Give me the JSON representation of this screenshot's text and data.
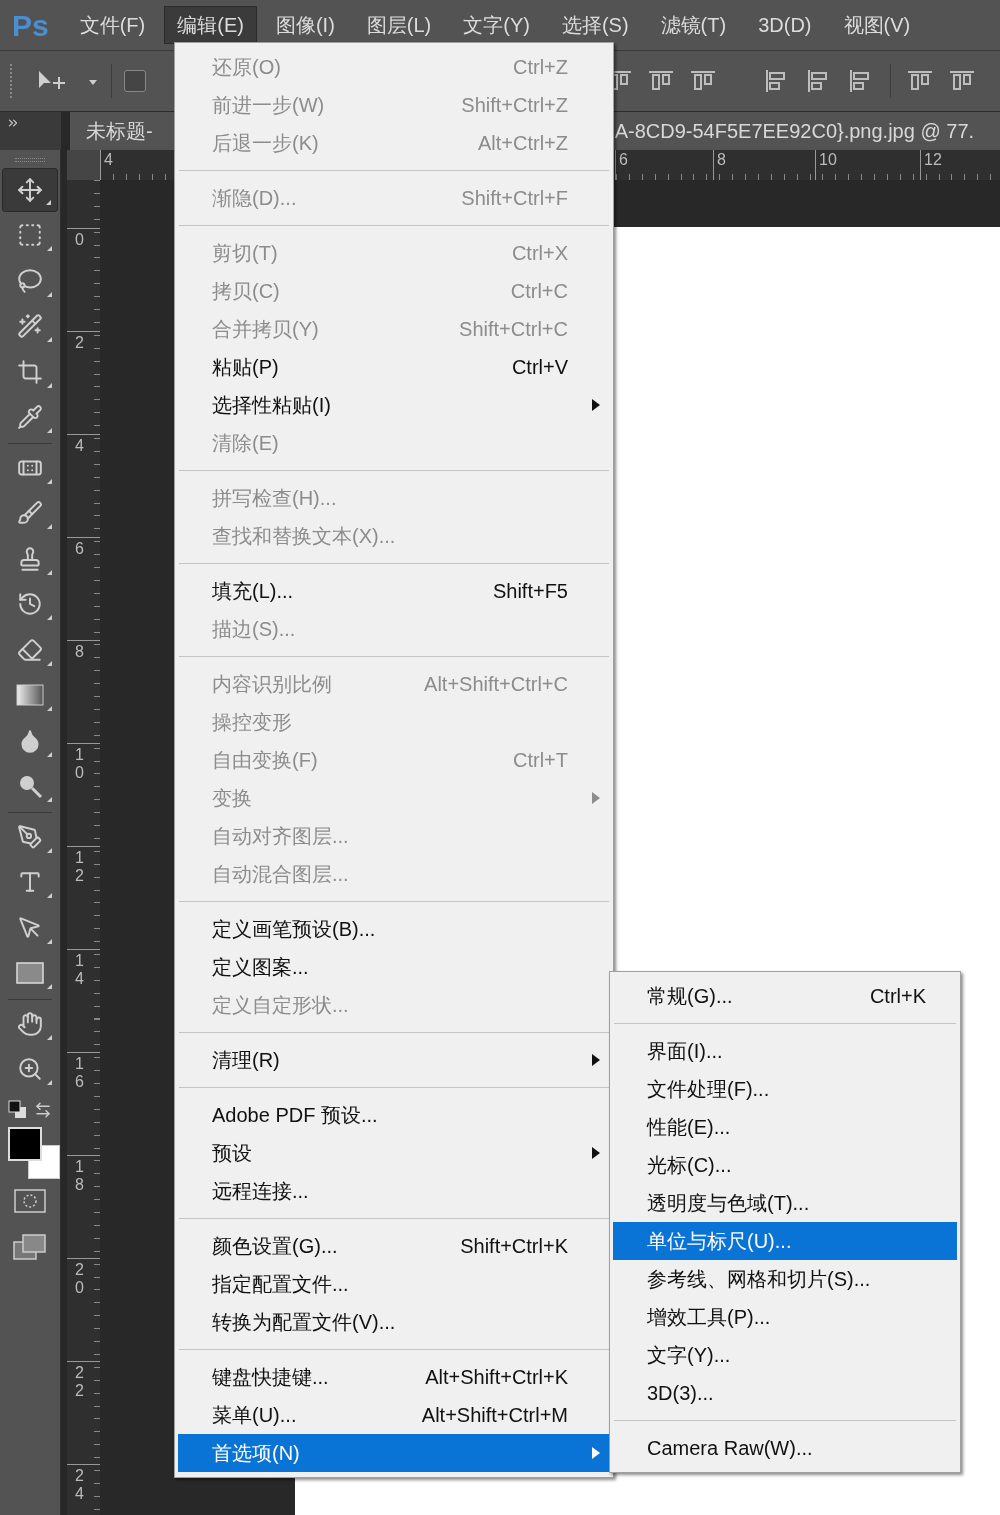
{
  "menu_bar": {
    "logo": "Ps",
    "items": [
      {
        "label": "文件(F)",
        "selected": false
      },
      {
        "label": "编辑(E)",
        "selected": true
      },
      {
        "label": "图像(I)",
        "selected": false
      },
      {
        "label": "图层(L)",
        "selected": false
      },
      {
        "label": "文字(Y)",
        "selected": false
      },
      {
        "label": "选择(S)",
        "selected": false
      },
      {
        "label": "滤镜(T)",
        "selected": false
      },
      {
        "label": "3D(D)",
        "selected": false
      },
      {
        "label": "视图(V)",
        "selected": false
      }
    ]
  },
  "options_bar": {
    "auto_select": {
      "checked": false
    }
  },
  "document_tab": {
    "title_left": "未标题-",
    "title_right": "A-8CD9-54F5E7EE92C0}.png.jpg @ 77."
  },
  "horizontal_ruler": [
    "4",
    "6",
    "8",
    "10",
    "12"
  ],
  "vertical_ruler": [
    "0",
    "2",
    "4",
    "6",
    "8",
    "10",
    "12",
    "14",
    "16",
    "18",
    "20",
    "22",
    "24"
  ],
  "tool_groups": [
    {
      "tools": [
        {
          "kind": "move",
          "selected": true
        },
        {
          "kind": "marquee",
          "selected": false
        },
        {
          "kind": "lasso",
          "selected": false
        },
        {
          "kind": "quick_select",
          "selected": false
        },
        {
          "kind": "crop",
          "selected": false
        },
        {
          "kind": "eyedropper",
          "selected": false
        }
      ]
    },
    {
      "tools": [
        {
          "kind": "healing",
          "selected": false
        },
        {
          "kind": "brush",
          "selected": false
        },
        {
          "kind": "stamp",
          "selected": false
        },
        {
          "kind": "history_brush",
          "selected": false
        },
        {
          "kind": "eraser",
          "selected": false
        },
        {
          "kind": "gradient",
          "selected": false
        },
        {
          "kind": "blur",
          "selected": false
        },
        {
          "kind": "dodge",
          "selected": false
        }
      ]
    },
    {
      "tools": [
        {
          "kind": "pen",
          "selected": false
        },
        {
          "kind": "type",
          "selected": false
        },
        {
          "kind": "path_select",
          "selected": false
        },
        {
          "kind": "shape",
          "selected": false
        }
      ]
    },
    {
      "tools": [
        {
          "kind": "hand",
          "selected": false
        },
        {
          "kind": "zoom",
          "selected": false
        }
      ]
    }
  ],
  "edit_menu": {
    "groups": [
      {
        "items": [
          {
            "label": "还原(O)",
            "shortcut": "Ctrl+Z",
            "enabled": false,
            "submenu": false,
            "selected": false
          },
          {
            "label": "前进一步(W)",
            "shortcut": "Shift+Ctrl+Z",
            "enabled": false,
            "submenu": false,
            "selected": false
          },
          {
            "label": "后退一步(K)",
            "shortcut": "Alt+Ctrl+Z",
            "enabled": false,
            "submenu": false,
            "selected": false
          }
        ]
      },
      {
        "items": [
          {
            "label": "渐隐(D)...",
            "shortcut": "Shift+Ctrl+F",
            "enabled": false,
            "submenu": false,
            "selected": false
          }
        ]
      },
      {
        "items": [
          {
            "label": "剪切(T)",
            "shortcut": "Ctrl+X",
            "enabled": false,
            "submenu": false,
            "selected": false
          },
          {
            "label": "拷贝(C)",
            "shortcut": "Ctrl+C",
            "enabled": false,
            "submenu": false,
            "selected": false
          },
          {
            "label": "合并拷贝(Y)",
            "shortcut": "Shift+Ctrl+C",
            "enabled": false,
            "submenu": false,
            "selected": false
          },
          {
            "label": "粘贴(P)",
            "shortcut": "Ctrl+V",
            "enabled": true,
            "submenu": false,
            "selected": false
          },
          {
            "label": "选择性粘贴(I)",
            "enabled": true,
            "submenu": true,
            "selected": false
          },
          {
            "label": "清除(E)",
            "enabled": false,
            "submenu": false,
            "selected": false
          }
        ]
      },
      {
        "items": [
          {
            "label": "拼写检查(H)...",
            "enabled": false,
            "submenu": false,
            "selected": false
          },
          {
            "label": "查找和替换文本(X)...",
            "enabled": false,
            "submenu": false,
            "selected": false
          }
        ]
      },
      {
        "items": [
          {
            "label": "填充(L)...",
            "shortcut": "Shift+F5",
            "enabled": true,
            "submenu": false,
            "selected": false
          },
          {
            "label": "描边(S)...",
            "enabled": false,
            "submenu": false,
            "selected": false
          }
        ]
      },
      {
        "items": [
          {
            "label": "内容识别比例",
            "shortcut": "Alt+Shift+Ctrl+C",
            "enabled": false,
            "submenu": false,
            "selected": false
          },
          {
            "label": "操控变形",
            "enabled": false,
            "submenu": false,
            "selected": false
          },
          {
            "label": "自由变换(F)",
            "shortcut": "Ctrl+T",
            "enabled": false,
            "submenu": false,
            "selected": false
          },
          {
            "label": "变换",
            "enabled": false,
            "submenu": true,
            "selected": false
          },
          {
            "label": "自动对齐图层...",
            "enabled": false,
            "submenu": false,
            "selected": false
          },
          {
            "label": "自动混合图层...",
            "enabled": false,
            "submenu": false,
            "selected": false
          }
        ]
      },
      {
        "items": [
          {
            "label": "定义画笔预设(B)...",
            "enabled": true,
            "submenu": false,
            "selected": false
          },
          {
            "label": "定义图案...",
            "enabled": true,
            "submenu": false,
            "selected": false
          },
          {
            "label": "定义自定形状...",
            "enabled": false,
            "submenu": false,
            "selected": false
          }
        ]
      },
      {
        "items": [
          {
            "label": "清理(R)",
            "enabled": true,
            "submenu": true,
            "selected": false
          }
        ]
      },
      {
        "items": [
          {
            "label": "Adobe PDF 预设...",
            "enabled": true,
            "submenu": false,
            "selected": false
          },
          {
            "label": "预设",
            "enabled": true,
            "submenu": true,
            "selected": false
          },
          {
            "label": "远程连接...",
            "enabled": true,
            "submenu": false,
            "selected": false
          }
        ]
      },
      {
        "items": [
          {
            "label": "颜色设置(G)...",
            "shortcut": "Shift+Ctrl+K",
            "enabled": true,
            "submenu": false,
            "selected": false
          },
          {
            "label": "指定配置文件...",
            "enabled": true,
            "submenu": false,
            "selected": false
          },
          {
            "label": "转换为配置文件(V)...",
            "enabled": true,
            "submenu": false,
            "selected": false
          }
        ]
      },
      {
        "items": [
          {
            "label": "键盘快捷键...",
            "shortcut": "Alt+Shift+Ctrl+K",
            "enabled": true,
            "submenu": false,
            "selected": false
          },
          {
            "label": "菜单(U)...",
            "shortcut": "Alt+Shift+Ctrl+M",
            "enabled": true,
            "submenu": false,
            "selected": false
          },
          {
            "label": "首选项(N)",
            "enabled": true,
            "submenu": true,
            "selected": true
          }
        ]
      }
    ]
  },
  "preferences_submenu": {
    "groups": [
      {
        "items": [
          {
            "label": "常规(G)...",
            "shortcut": "Ctrl+K",
            "selected": false
          }
        ]
      },
      {
        "items": [
          {
            "label": "界面(I)...",
            "selected": false
          },
          {
            "label": "文件处理(F)...",
            "selected": false
          },
          {
            "label": "性能(E)...",
            "selected": false
          },
          {
            "label": "光标(C)...",
            "selected": false
          },
          {
            "label": "透明度与色域(T)...",
            "selected": false
          },
          {
            "label": "单位与标尺(U)...",
            "selected": true
          },
          {
            "label": "参考线、网格和切片(S)...",
            "selected": false
          },
          {
            "label": "增效工具(P)...",
            "selected": false
          },
          {
            "label": "文字(Y)...",
            "selected": false
          },
          {
            "label": "3D(3)...",
            "selected": false
          }
        ]
      },
      {
        "items": [
          {
            "label": "Camera Raw(W)...",
            "selected": false
          }
        ]
      }
    ]
  }
}
